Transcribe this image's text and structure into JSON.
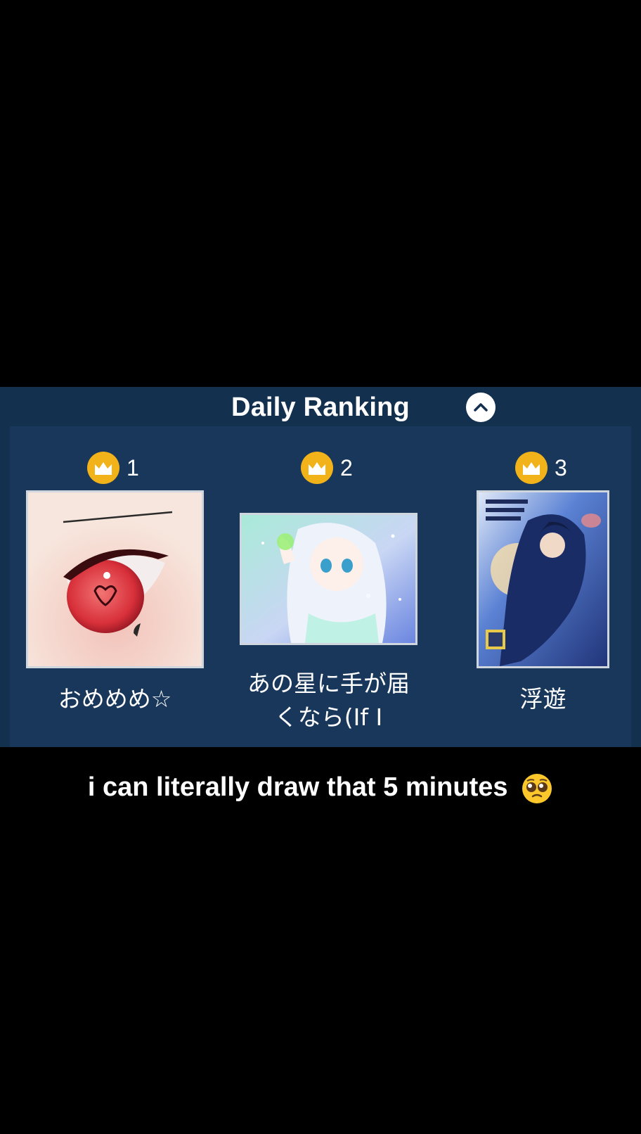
{
  "panel": {
    "title": "Daily Ranking",
    "collapse_icon": "chevron-up-icon",
    "colors": {
      "background": "#14304f",
      "crown": "#f2b21a"
    }
  },
  "rankings": [
    {
      "rank": "1",
      "title": "おめめめ☆",
      "thumbnail": "red-eye-artwork"
    },
    {
      "rank": "2",
      "title_line1": "あの星に手が届",
      "title_line2": "くなら(If I",
      "thumbnail": "girl-reaching-star-artwork"
    },
    {
      "rank": "3",
      "title": "浮遊",
      "thumbnail": "floating-figure-poster-artwork"
    }
  ],
  "caption": {
    "text": "i can literally draw that 5 minutes",
    "emoji": "pleading-face-emoji"
  }
}
